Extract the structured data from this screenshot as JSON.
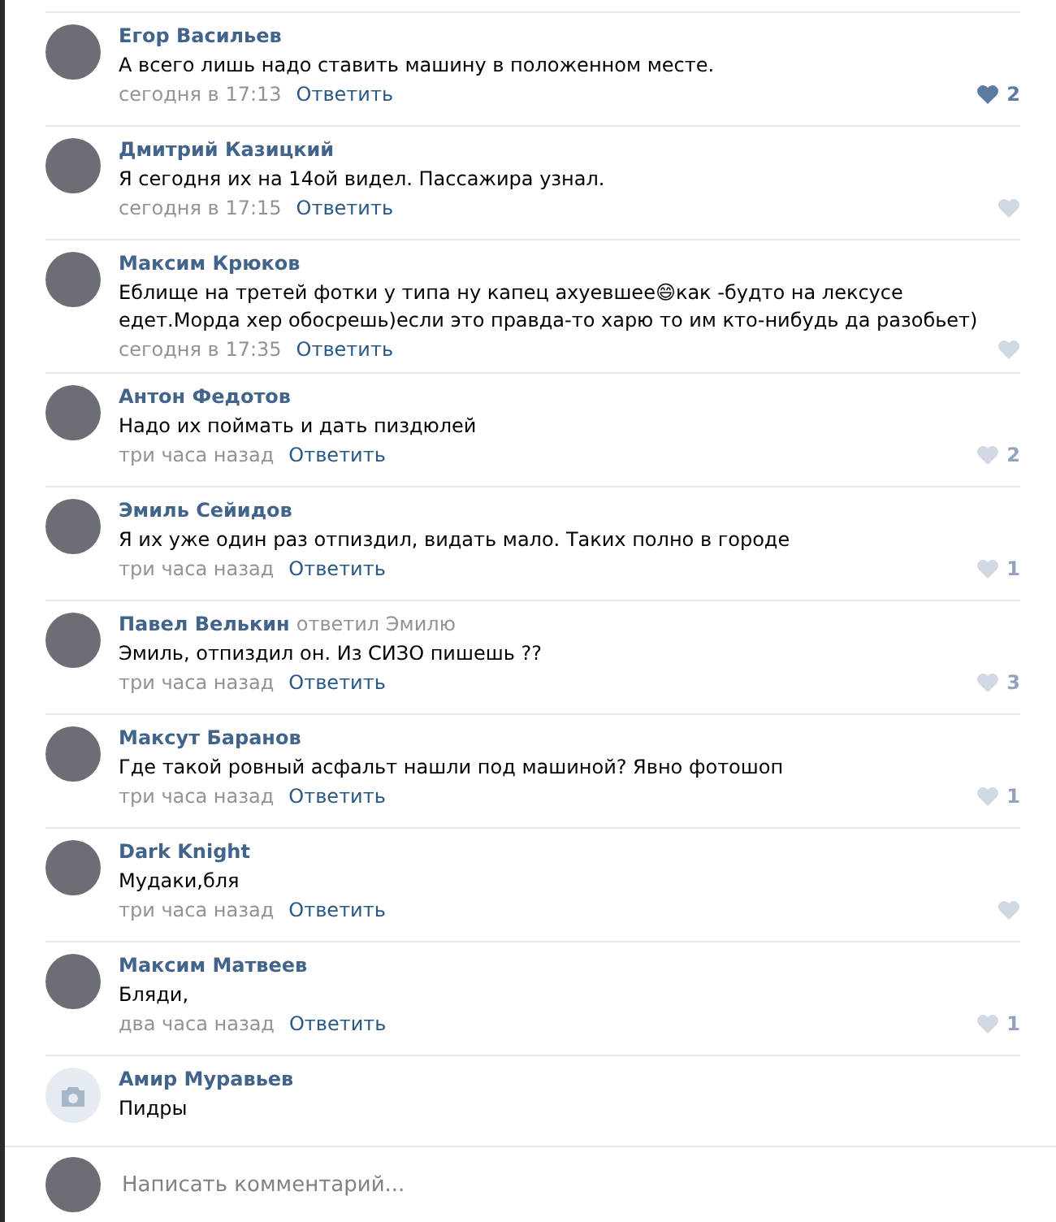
{
  "comments": [
    {
      "author": "Егор Васильев",
      "text": "А всего лишь надо ставить машину в положенном месте.",
      "time": "сегодня в 17:13",
      "reply": "Ответить",
      "likes": "2",
      "liked": true,
      "kind": "photo"
    },
    {
      "author": "Дмитрий Казицкий",
      "text": "Я сегодня их на 14ой видел. Пассажира узнал.",
      "time": "сегодня в 17:15",
      "reply": "Ответить",
      "liked": false,
      "kind": "photo"
    },
    {
      "author": "Максим Крюков",
      "text": "Еблище на третей фотки у типа ну капец ахуевшее😄как -будто на лексусе едет.Морда хер обосрешь)если это правда-то харю то им кто-нибудь да разобьет)",
      "time": "сегодня в 17:35",
      "reply": "Ответить",
      "liked": false,
      "kind": "photo"
    },
    {
      "author": "Антон Федотов",
      "text": "Надо их поймать и дать пиздюлей",
      "time": "три часа назад",
      "reply": "Ответить",
      "likes": "2",
      "liked": false,
      "kind": "photo"
    },
    {
      "author": "Эмиль Сейидов",
      "text": "Я их уже один раз отпиздил, видать мало. Таких полно в городе",
      "time": "три часа назад",
      "reply": "Ответить",
      "likes": "1",
      "liked": false,
      "kind": "photo"
    },
    {
      "author": "Павел Велькин",
      "reply_note": "ответил Эмилю",
      "text": "Эмиль, отпиздил он. Из СИЗО пишешь ??",
      "time": "три часа назад",
      "reply": "Ответить",
      "likes": "3",
      "liked": false,
      "kind": "photo"
    },
    {
      "author": "Максут Баранов",
      "text": "Где такой ровный асфальт нашли под машиной? Явно фотошоп",
      "time": "три часа назад",
      "reply": "Ответить",
      "likes": "1",
      "liked": false,
      "kind": "photo"
    },
    {
      "author": "Dark Knight",
      "text": "Мудаки,бля",
      "time": "три часа назад",
      "reply": "Ответить",
      "liked": false,
      "kind": "photo"
    },
    {
      "author": "Максим Матвеев",
      "text": "Бляди,",
      "time": "два часа назад",
      "reply": "Ответить",
      "likes": "1",
      "liked": false,
      "kind": "photo"
    },
    {
      "author": "Амир Муравьев",
      "text": "Пидры",
      "kind": "camera"
    }
  ],
  "composer": {
    "placeholder": "Написать комментарий..."
  }
}
